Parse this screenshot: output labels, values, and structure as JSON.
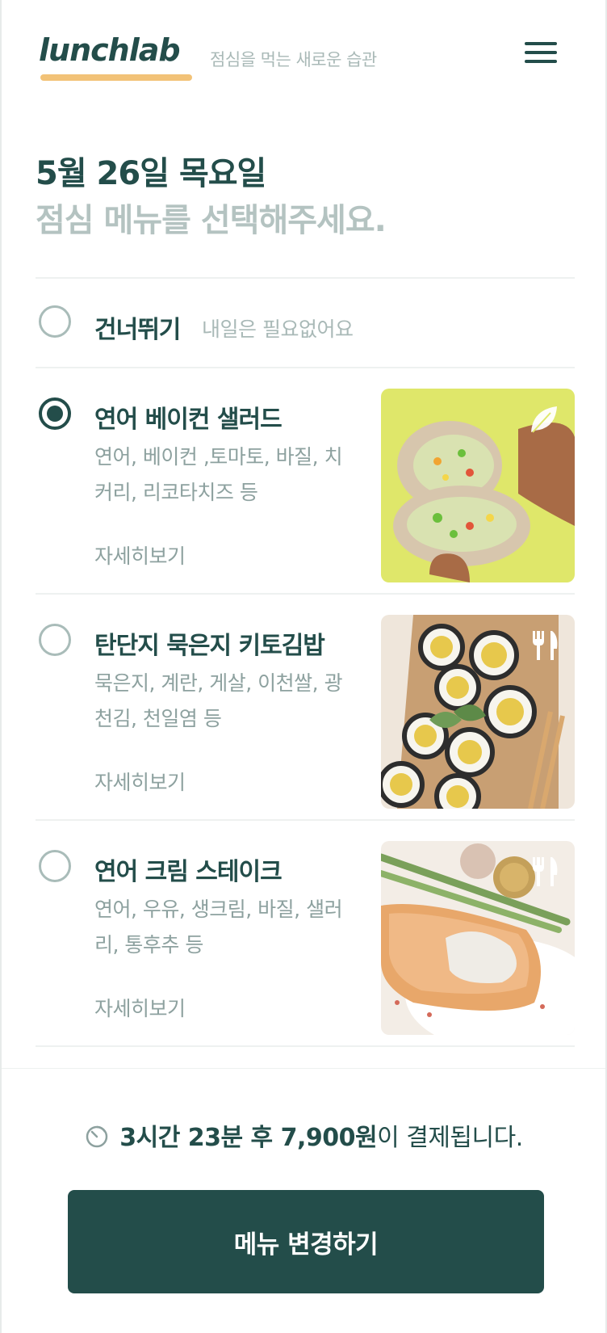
{
  "header": {
    "logo": "lunchlab",
    "tagline": "점심을 먹는 새로운 습관",
    "menu_icon": "hamburger-menu-icon"
  },
  "headline": {
    "date": "5월 26일 목요일",
    "prompt": "점심 메뉴를 선택해주세요."
  },
  "skip": {
    "label": "건너뛰기",
    "note": "내일은 필요없어요",
    "selected": false
  },
  "menu_items": [
    {
      "title": "연어 베이컨 샐러드",
      "ingredients": "연어, 베이컨 ,토마토, 바질, 치커리, 리코타치즈 등",
      "more": "자세히보기",
      "selected": true,
      "badge_icon": "leaf-icon",
      "image_colors": {
        "bg": "#dfe76a",
        "accent": "#d8c6a9"
      }
    },
    {
      "title": "탄단지 묵은지 키토김밥",
      "ingredients": "묵은지, 계란, 게살, 이천쌀, 광천김, 천일염 등",
      "more": "자세히보기",
      "selected": false,
      "badge_icon": "fork-knife-icon",
      "image_colors": {
        "bg": "#efe6db",
        "accent": "#c49a6c"
      }
    },
    {
      "title": "연어 크림 스테이크",
      "ingredients": "연어, 우유, 생크림, 바질, 샐러리, 통후추 등",
      "more": "자세히보기",
      "selected": false,
      "badge_icon": "fork-knife-icon",
      "image_colors": {
        "bg": "#f3ede6",
        "accent": "#e8a76a"
      }
    }
  ],
  "footer": {
    "clock_icon": "timer-icon",
    "notice_strong": "3시간 23분 후 7,900원",
    "notice_rest": "이 결제됩니다.",
    "cta_label": "메뉴 변경하기"
  },
  "colors": {
    "brand": "#234d4a",
    "accent_underline": "#f2c277",
    "muted": "#a9b9b7"
  }
}
